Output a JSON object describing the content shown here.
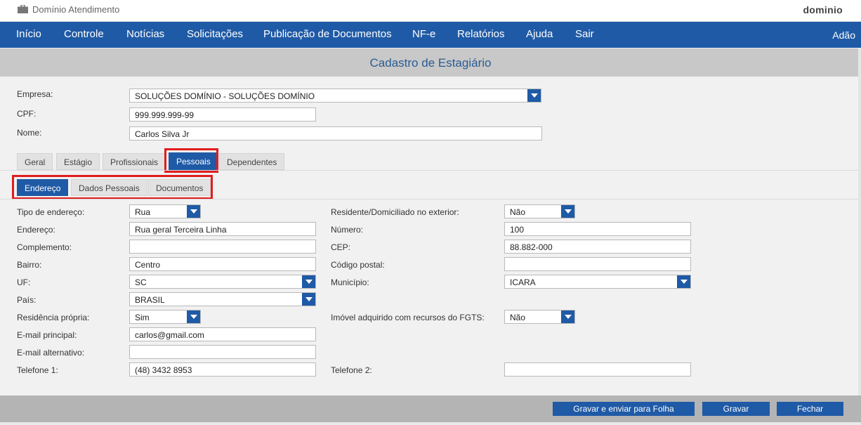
{
  "window": {
    "title": "Domínio Atendimento",
    "logo": "dominio",
    "icon": "briefcase-icon"
  },
  "nav": {
    "items": [
      "Início",
      "Controle",
      "Notícias",
      "Solicitações",
      "Publicação de Documentos",
      "NF-e",
      "Relatórios",
      "Ajuda",
      "Sair"
    ],
    "user": "Adão"
  },
  "page": {
    "title": "Cadastro de Estagiário"
  },
  "header_form": {
    "empresa_label": "Empresa:",
    "empresa_value": "SOLUÇÕES DOMÍNIO - SOLUÇÕES DOMÍNIO",
    "cpf_label": "CPF:",
    "cpf_value": "999.999.999-99",
    "nome_label": "Nome:",
    "nome_value": "Carlos Silva Jr"
  },
  "tabs": [
    "Geral",
    "Estágio",
    "Profissionais",
    "Pessoais",
    "Dependentes"
  ],
  "active_tab": "Pessoais",
  "subtabs": [
    "Endereço",
    "Dados Pessoais",
    "Documentos"
  ],
  "active_subtab": "Endereço",
  "left_fields": [
    {
      "label": "Tipo de endereço:",
      "value": "Rua",
      "type": "select"
    },
    {
      "label": "Endereço:",
      "value": "Rua geral Terceira Linha",
      "type": "text"
    },
    {
      "label": "Complemento:",
      "value": "",
      "type": "text"
    },
    {
      "label": "Bairro:",
      "value": "Centro",
      "type": "text"
    },
    {
      "label": "UF:",
      "value": "SC",
      "type": "select"
    },
    {
      "label": "País:",
      "value": "BRASIL",
      "type": "select"
    },
    {
      "label": "Residência própria:",
      "value": "Sim",
      "type": "select"
    },
    {
      "label": "E-mail principal:",
      "value": "carlos@gmail.com",
      "type": "text"
    },
    {
      "label": "E-mail alternativo:",
      "value": "",
      "type": "text"
    },
    {
      "label": "Telefone 1:",
      "value": "(48) 3432 8953",
      "type": "text"
    }
  ],
  "right_fields": [
    {
      "label": "Residente/Domiciliado no exterior:",
      "value": "Não",
      "type": "select"
    },
    {
      "label": "Número:",
      "value": "100",
      "type": "text"
    },
    {
      "label": "CEP:",
      "value": "88.882-000",
      "type": "text"
    },
    {
      "label": "Código postal:",
      "value": "",
      "type": "text"
    },
    {
      "label": "Município:",
      "value": "ICARA",
      "type": "select"
    },
    {
      "label": "Imóvel adquirido com recursos do FGTS:",
      "value": "Não",
      "type": "select"
    },
    {
      "label": "Telefone 2:",
      "value": "",
      "type": "text"
    }
  ],
  "buttons": {
    "save_send": "Gravar e enviar para Folha",
    "save": "Gravar",
    "close": "Fechar"
  },
  "colors": {
    "brand_blue": "#1f5aa6",
    "highlight_red": "#e11d1d",
    "title_blue": "#2a5c93"
  }
}
